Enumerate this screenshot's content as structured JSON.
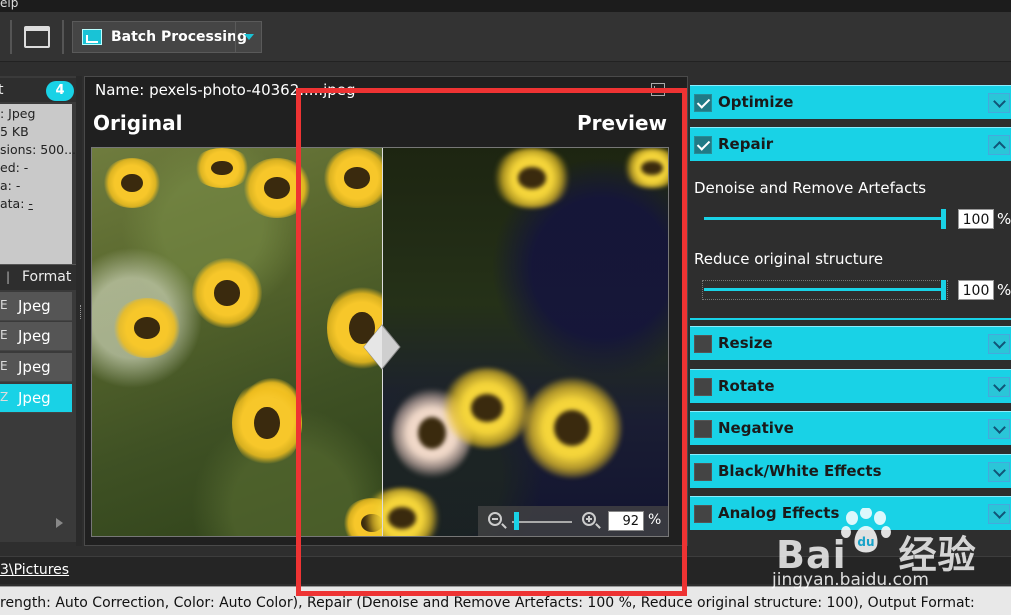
{
  "menubar": {
    "partial_menu": "elp"
  },
  "toolbar": {
    "batch_label": "Batch Processing"
  },
  "file_panel": {
    "header_partial": "t",
    "count": "4",
    "info_lines": [
      ": Jpeg",
      "5 KB",
      "sions: 500...",
      "ed: -",
      "a: -",
      "ata: "
    ],
    "info_link": "-",
    "column_header": "Format",
    "rows": [
      {
        "format": "Jpeg",
        "selected": false
      },
      {
        "format": "Jpeg",
        "selected": false
      },
      {
        "format": "Jpeg",
        "selected": false
      },
      {
        "format": "Jpeg",
        "selected": true
      }
    ]
  },
  "viewer": {
    "name_label": "Name: pexels-photo-40362.....jpeg",
    "original_label": "Original",
    "preview_label": "Preview",
    "zoom_value": "92",
    "zoom_unit": "%"
  },
  "settings": {
    "sections": {
      "optimize": {
        "label": "Optimize",
        "checked": true,
        "expanded": false
      },
      "repair": {
        "label": "Repair",
        "checked": true,
        "expanded": true
      },
      "resize": {
        "label": "Resize",
        "checked": false
      },
      "rotate": {
        "label": "Rotate",
        "checked": false
      },
      "negative": {
        "label": "Negative",
        "checked": false
      },
      "bw": {
        "label": "Black/White Effects",
        "checked": false
      },
      "analog": {
        "label": "Analog Effects",
        "checked": false
      }
    },
    "repair_params": {
      "denoise_label": "Denoise and Remove Artefacts",
      "denoise_value": "100",
      "structure_label": "Reduce original structure",
      "structure_value": "100",
      "unit": "%"
    }
  },
  "path": {
    "text": "3\\Pictures"
  },
  "status": {
    "text": "rength: Auto Correction, Color: Auto Color), Repair (Denoise and Remove Artefacts: 100 %, Reduce original structure: 100), Output Format:"
  },
  "watermark": {
    "brand": "Bai",
    "brand_suffix": "经验",
    "url": "jingyan.baidu.com"
  },
  "colors": {
    "accent": "#19d2e6",
    "annotation": "#ee3333",
    "panel": "#2e2e2e"
  }
}
